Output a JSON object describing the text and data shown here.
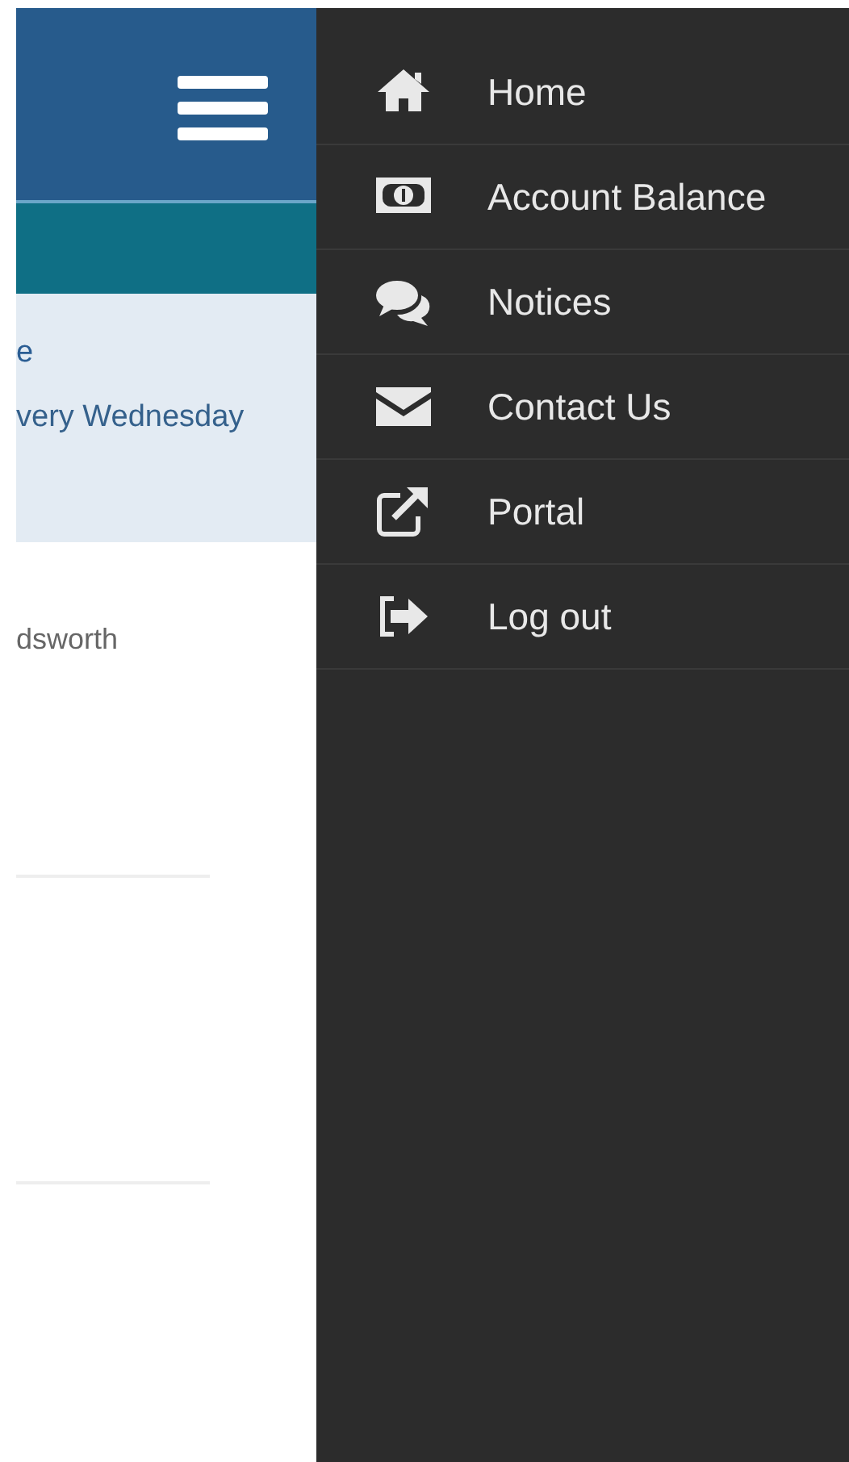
{
  "page": {
    "card_lines": [
      "e",
      "very Wednesday"
    ],
    "body_text": "dsworth"
  },
  "menu": [
    {
      "label": "Home"
    },
    {
      "label": "Account Balance"
    },
    {
      "label": "Notices"
    },
    {
      "label": "Contact Us"
    },
    {
      "label": "Portal"
    },
    {
      "label": "Log out"
    }
  ]
}
